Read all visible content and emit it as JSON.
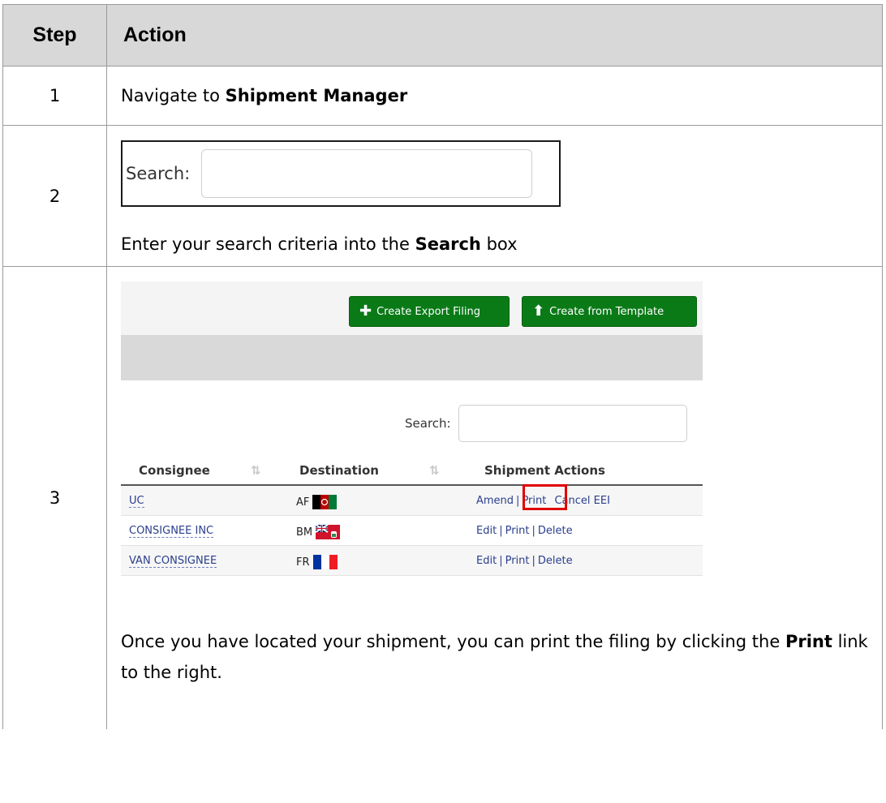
{
  "header": {
    "step": "Step",
    "action": "Action"
  },
  "rows": [
    {
      "step": "1",
      "text_before": "Navigate to ",
      "bold": "Shipment Manager",
      "text_after": ""
    },
    {
      "step": "2",
      "search_label": "Search:",
      "text_before": "Enter your search criteria into the ",
      "bold": "Search",
      "text_after": " box"
    },
    {
      "step": "3",
      "text_before": "Once you have located your shipment, you can print the filing by clicking the ",
      "bold": "Print",
      "text_after": " link to the right."
    }
  ],
  "app": {
    "btn_export": "Create Export Filing",
    "btn_template": "Create from Template",
    "search_label": "Search:",
    "columns": {
      "consignee": "Consignee",
      "destination": "Destination",
      "actions": "Shipment Actions"
    },
    "records": [
      {
        "consignee": "UC",
        "dest": "AF",
        "a1": "Amend",
        "a2": "Print",
        "a3": "Cancel EEI"
      },
      {
        "consignee": "CONSIGNEE INC",
        "dest": "BM",
        "a1": "Edit",
        "a2": "Print",
        "a3": "Delete"
      },
      {
        "consignee": "VAN CONSIGNEE",
        "dest": "FR",
        "a1": "Edit",
        "a2": "Print",
        "a3": "Delete"
      }
    ]
  }
}
